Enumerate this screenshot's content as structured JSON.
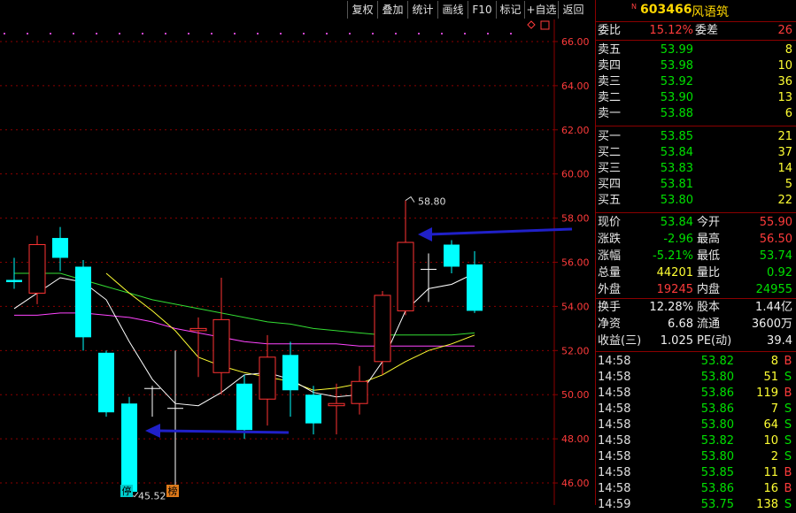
{
  "toolbar": {
    "buttons": [
      "复权",
      "叠加",
      "统计",
      "画线",
      "F10",
      "标记",
      "+自选",
      "返回"
    ]
  },
  "stock": {
    "badge": "N",
    "code": "603466",
    "name": "风语筑"
  },
  "weibi": {
    "label1": "委比",
    "value1": "15.12%",
    "label2": "委差",
    "value2": "26"
  },
  "asks": [
    {
      "label": "卖五",
      "price": "53.99",
      "vol": "8"
    },
    {
      "label": "卖四",
      "price": "53.98",
      "vol": "10"
    },
    {
      "label": "卖三",
      "price": "53.92",
      "vol": "36"
    },
    {
      "label": "卖二",
      "price": "53.90",
      "vol": "13"
    },
    {
      "label": "卖一",
      "price": "53.88",
      "vol": "6"
    }
  ],
  "bids": [
    {
      "label": "买一",
      "price": "53.85",
      "vol": "21"
    },
    {
      "label": "买二",
      "price": "53.84",
      "vol": "37"
    },
    {
      "label": "买三",
      "price": "53.83",
      "vol": "14"
    },
    {
      "label": "买四",
      "price": "53.81",
      "vol": "5"
    },
    {
      "label": "买五",
      "price": "53.80",
      "vol": "22"
    }
  ],
  "quote": [
    {
      "l1": "现价",
      "v1": "53.84",
      "c1": "green",
      "l2": "今开",
      "v2": "55.90",
      "c2": "red"
    },
    {
      "l1": "涨跌",
      "v1": "-2.96",
      "c1": "green",
      "l2": "最高",
      "v2": "56.50",
      "c2": "red"
    },
    {
      "l1": "涨幅",
      "v1": "-5.21%",
      "c1": "green",
      "l2": "最低",
      "v2": "53.74",
      "c2": "green"
    },
    {
      "l1": "总量",
      "v1": "44201",
      "c1": "yellow",
      "l2": "量比",
      "v2": "0.92",
      "c2": "green"
    },
    {
      "l1": "外盘",
      "v1": "19245",
      "c1": "red",
      "l2": "内盘",
      "v2": "24955",
      "c2": "green"
    }
  ],
  "fund": [
    {
      "l1": "换手",
      "v1": "12.28%",
      "l2": "股本",
      "v2": "1.44亿"
    },
    {
      "l1": "净资",
      "v1": "6.68",
      "l2": "流通",
      "v2": "3600万"
    },
    {
      "l1": "收益(三)",
      "v1": "1.025",
      "l2": "PE(动)",
      "v2": "39.4"
    }
  ],
  "ticks": [
    {
      "time": "14:58",
      "price": "53.82",
      "vol": "8",
      "bs": "B"
    },
    {
      "time": "14:58",
      "price": "53.80",
      "vol": "51",
      "bs": "S"
    },
    {
      "time": "14:58",
      "price": "53.86",
      "vol": "119",
      "bs": "B"
    },
    {
      "time": "14:58",
      "price": "53.86",
      "vol": "7",
      "bs": "S"
    },
    {
      "time": "14:58",
      "price": "53.80",
      "vol": "64",
      "bs": "S"
    },
    {
      "time": "14:58",
      "price": "53.82",
      "vol": "10",
      "bs": "S"
    },
    {
      "time": "14:58",
      "price": "53.80",
      "vol": "2",
      "bs": "S"
    },
    {
      "time": "14:58",
      "price": "53.85",
      "vol": "11",
      "bs": "B"
    },
    {
      "time": "14:58",
      "price": "53.86",
      "vol": "16",
      "bs": "B"
    },
    {
      "time": "14:59",
      "price": "53.75",
      "vol": "138",
      "bs": "S"
    }
  ],
  "chart_data": {
    "type": "candlestick",
    "y_ticks": [
      "66.00",
      "64.00",
      "62.00",
      "60.00",
      "58.00",
      "56.00",
      "54.00",
      "52.00",
      "50.00",
      "48.00",
      "46.00"
    ],
    "ylim": [
      45,
      67
    ],
    "annotations": {
      "high_label": "58.80",
      "low_label": "45.52",
      "tag_ting": "停",
      "tag_bang": "榜"
    },
    "colors": {
      "up": "#ff3333",
      "down": "#00ffff",
      "ma_white": "#ffffff",
      "ma_yellow": "#ffff33",
      "ma_green": "#33dd33",
      "ma_magenta": "#ff44ff",
      "arrow": "#2020c8"
    },
    "candles": [
      {
        "o": 55.2,
        "c": 55.1,
        "h": 56.2,
        "l": 54.8
      },
      {
        "o": 54.6,
        "c": 56.8,
        "h": 57.2,
        "l": 54.1
      },
      {
        "o": 57.1,
        "c": 56.2,
        "h": 57.6,
        "l": 55.6
      },
      {
        "o": 55.8,
        "c": 52.6,
        "h": 56.1,
        "l": 52.0
      },
      {
        "o": 51.9,
        "c": 49.2,
        "h": 52.0,
        "l": 49.0
      },
      {
        "o": 49.6,
        "c": 45.6,
        "h": 49.9,
        "l": 45.5
      },
      {
        "o": 50.3,
        "c": 50.3,
        "h": 50.4,
        "l": 49.0
      },
      {
        "o": 49.4,
        "c": 49.4,
        "h": 52.0,
        "l": 45.8
      },
      {
        "o": 52.9,
        "c": 53.0,
        "h": 53.5,
        "l": 50.8
      },
      {
        "o": 51.0,
        "c": 53.4,
        "h": 55.3,
        "l": 50.0
      },
      {
        "o": 50.5,
        "c": 48.4,
        "h": 50.9,
        "l": 48.0
      },
      {
        "o": 49.8,
        "c": 51.7,
        "h": 52.7,
        "l": 48.6
      },
      {
        "o": 51.8,
        "c": 50.2,
        "h": 52.4,
        "l": 49.0
      },
      {
        "o": 50.0,
        "c": 48.7,
        "h": 50.4,
        "l": 48.2
      },
      {
        "o": 49.5,
        "c": 49.6,
        "h": 50.5,
        "l": 48.2
      },
      {
        "o": 49.6,
        "c": 50.6,
        "h": 51.3,
        "l": 49.1
      },
      {
        "o": 51.5,
        "c": 54.5,
        "h": 54.7,
        "l": 50.9
      },
      {
        "o": 53.8,
        "c": 56.9,
        "h": 58.8,
        "l": 53.6
      },
      {
        "o": 55.7,
        "c": 55.7,
        "h": 56.4,
        "l": 54.2
      },
      {
        "o": 56.8,
        "c": 55.8,
        "h": 57.0,
        "l": 55.5
      },
      {
        "o": 55.9,
        "c": 53.8,
        "h": 56.5,
        "l": 53.7
      }
    ],
    "ma_white": [
      53.9,
      54.6,
      55.3,
      55.1,
      54.3,
      52.4,
      50.7,
      49.6,
      49.5,
      50.1,
      50.9,
      51.0,
      50.7,
      50.1,
      49.9,
      50.0,
      51.5,
      53.8,
      54.8,
      55.0,
      55.5
    ],
    "ma_yellow": [
      null,
      null,
      null,
      null,
      55.5,
      54.6,
      53.8,
      52.9,
      51.7,
      51.3,
      51.0,
      50.8,
      50.6,
      50.2,
      50.3,
      50.5,
      50.9,
      51.5,
      52.0,
      52.3,
      52.7
    ],
    "ma_green": [
      55.5,
      55.5,
      55.5,
      55.2,
      54.9,
      54.6,
      54.3,
      54.1,
      53.9,
      53.7,
      53.5,
      53.3,
      53.2,
      53.0,
      52.9,
      52.8,
      52.7,
      52.7,
      52.7,
      52.7,
      52.8
    ],
    "ma_magenta": [
      53.6,
      53.6,
      53.7,
      53.7,
      53.6,
      53.5,
      53.3,
      53.0,
      52.8,
      52.6,
      52.4,
      52.3,
      52.3,
      52.3,
      52.3,
      52.2,
      52.2,
      52.2,
      52.2,
      52.2,
      52.2
    ]
  }
}
